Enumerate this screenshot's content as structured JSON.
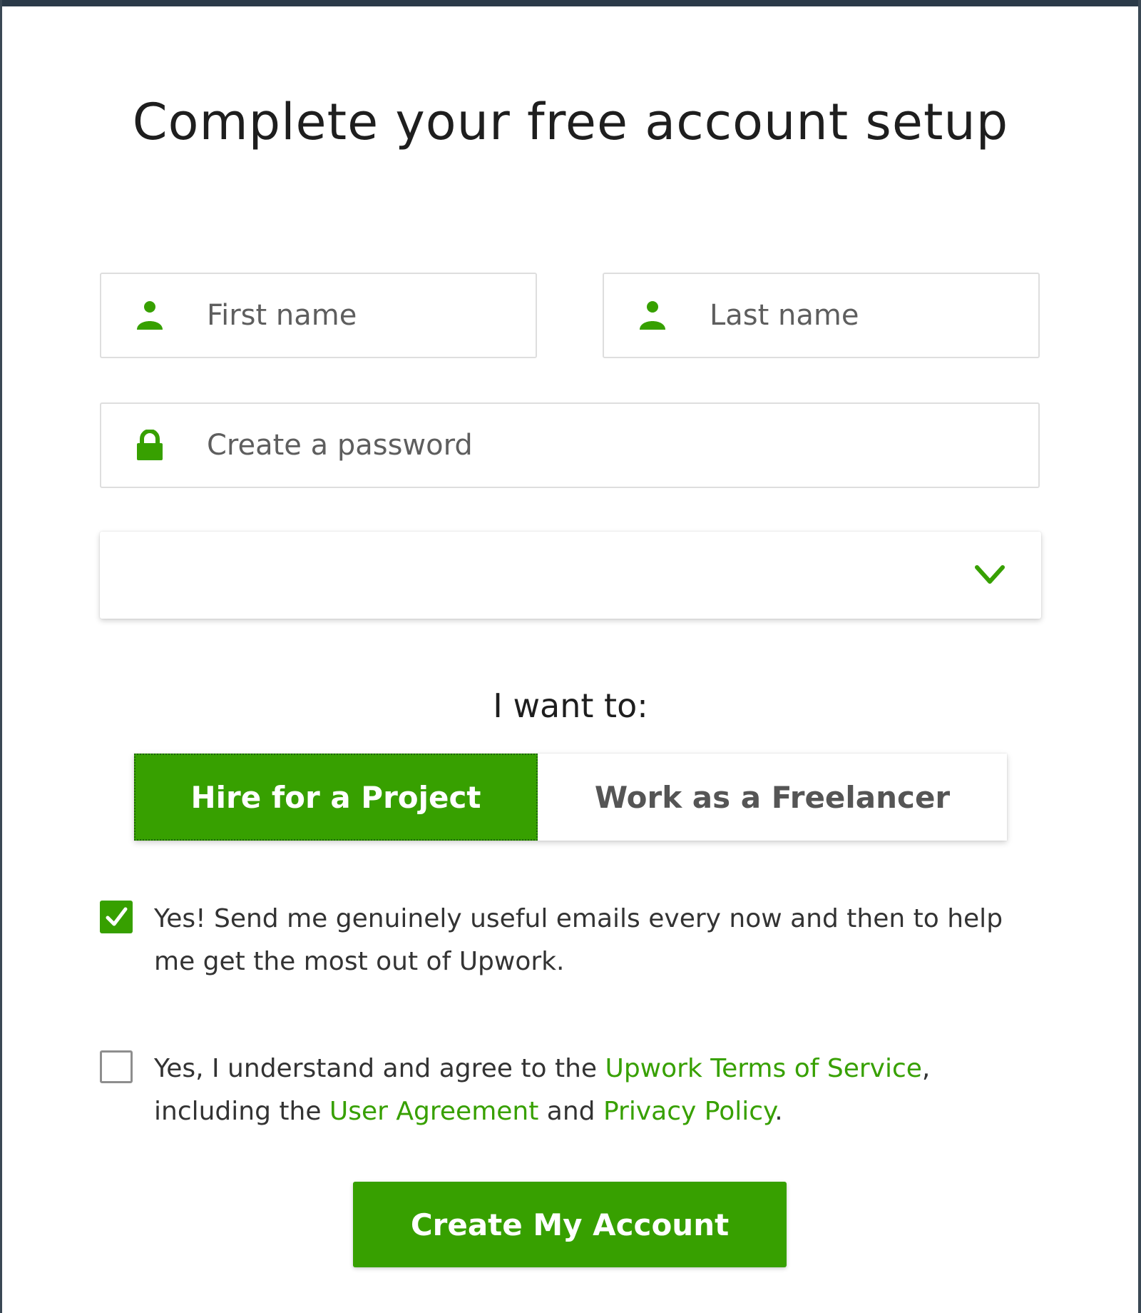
{
  "page": {
    "title": "Complete your free account setup"
  },
  "form": {
    "first_name": {
      "placeholder": "First name",
      "value": "",
      "icon": "user-icon"
    },
    "last_name": {
      "placeholder": "Last name",
      "value": "",
      "icon": "user-icon"
    },
    "password": {
      "placeholder": "Create a password",
      "value": "",
      "icon": "lock-icon"
    },
    "country_select": {
      "value": "",
      "icon": "chevron-down-icon"
    }
  },
  "role": {
    "label": "I want to:",
    "options": [
      "Hire for a Project",
      "Work as a Freelancer"
    ],
    "selected": "Hire for a Project"
  },
  "consents": {
    "emails": {
      "checked": true,
      "text": "Yes! Send me genuinely useful emails every now and then to help me get the most out of Upwork."
    },
    "terms": {
      "checked": false,
      "prefix": "Yes, I understand and agree to the ",
      "tos_link": "Upwork Terms of Service",
      "middle1": ", including the ",
      "ua_link": "User Agreement",
      "middle2": " and ",
      "pp_link": "Privacy Policy",
      "suffix": "."
    }
  },
  "submit": {
    "label": "Create My Account"
  },
  "colors": {
    "accent": "#37a000",
    "text": "#1e1e1e",
    "border": "#dedede",
    "frame": "#2b3a48"
  }
}
